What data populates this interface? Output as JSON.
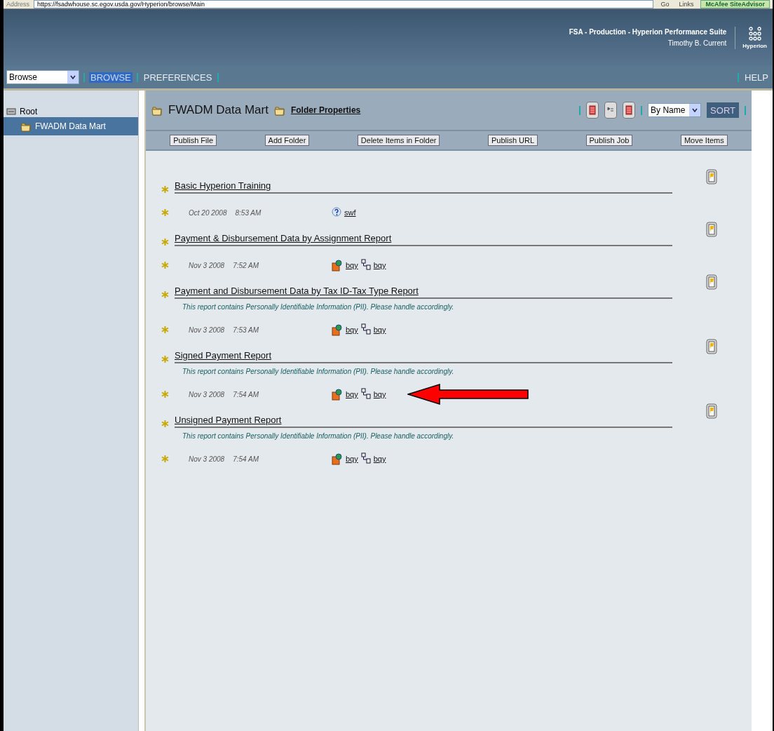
{
  "address_bar": {
    "label": "Address",
    "url": "https://fsadwhouse.sc.egov.usda.gov/Hyperion/browse/Main",
    "go": "Go",
    "links": "Links",
    "addon": "McAfee SiteAdvisor"
  },
  "header": {
    "product": "FSA - Production - Hyperion Performance Suite",
    "user": "Timothy B. Current",
    "logo": "Hyperion"
  },
  "nav": {
    "module_select": "Browse",
    "tabs": [
      {
        "label": "BROWSE",
        "selected": true
      },
      {
        "label": "PREFERENCES",
        "selected": false
      }
    ],
    "help": "HELP"
  },
  "sidebar": {
    "items": [
      {
        "label": "Root",
        "kind": "root",
        "selected": false,
        "children": [
          {
            "label": "FWADM Data Mart",
            "kind": "folder",
            "selected": true
          }
        ]
      }
    ]
  },
  "folder": {
    "title": "FWADM Data Mart",
    "properties_link": "Folder Properties",
    "sort_select": "By Name",
    "sort_button": "SORT",
    "actions": [
      "Publish File",
      "Add Folder",
      "Delete Items in Folder",
      "Publish URL",
      "Publish Job",
      "Move Items"
    ],
    "items": [
      {
        "title": "Basic Hyperion Training",
        "date": "Oct 20 2008",
        "time": "8:53 AM",
        "marked": false,
        "files": [
          {
            "kind": "help",
            "label": "swf"
          }
        ]
      },
      {
        "title": "Payment & Disbursement Data by Assignment Report",
        "date": "Nov 3 2008",
        "time": "7:52 AM",
        "marked": false,
        "files": [
          {
            "kind": "report",
            "label": "bqy"
          },
          {
            "kind": "job",
            "label": "bqy"
          }
        ]
      },
      {
        "title": "Payment and Disbursement Data by Tax ID-Tax Type Report",
        "note": "This report contains Personally Identifiable Information (PII). Please handle accordingly.",
        "date": "Nov 3 2008",
        "time": "7:53 AM",
        "marked": false,
        "files": [
          {
            "kind": "report",
            "label": "bqy"
          },
          {
            "kind": "job",
            "label": "bqy"
          }
        ]
      },
      {
        "title": "Signed Payment Report",
        "note": "This report contains Personally Identifiable Information (PII). Please handle accordingly.",
        "date": "Nov 3 2008",
        "time": "7:54 AM",
        "marked": true,
        "files": [
          {
            "kind": "report",
            "label": "bqy"
          },
          {
            "kind": "job",
            "label": "bqy"
          }
        ]
      },
      {
        "title": "Unsigned Payment Report",
        "note": "This report contains Personally Identifiable Information (PII). Please handle accordingly.",
        "date": "Nov 3 2008",
        "time": "7:54 AM",
        "marked": false,
        "files": [
          {
            "kind": "report",
            "label": "bqy"
          },
          {
            "kind": "job",
            "label": "bqy"
          }
        ]
      }
    ]
  }
}
